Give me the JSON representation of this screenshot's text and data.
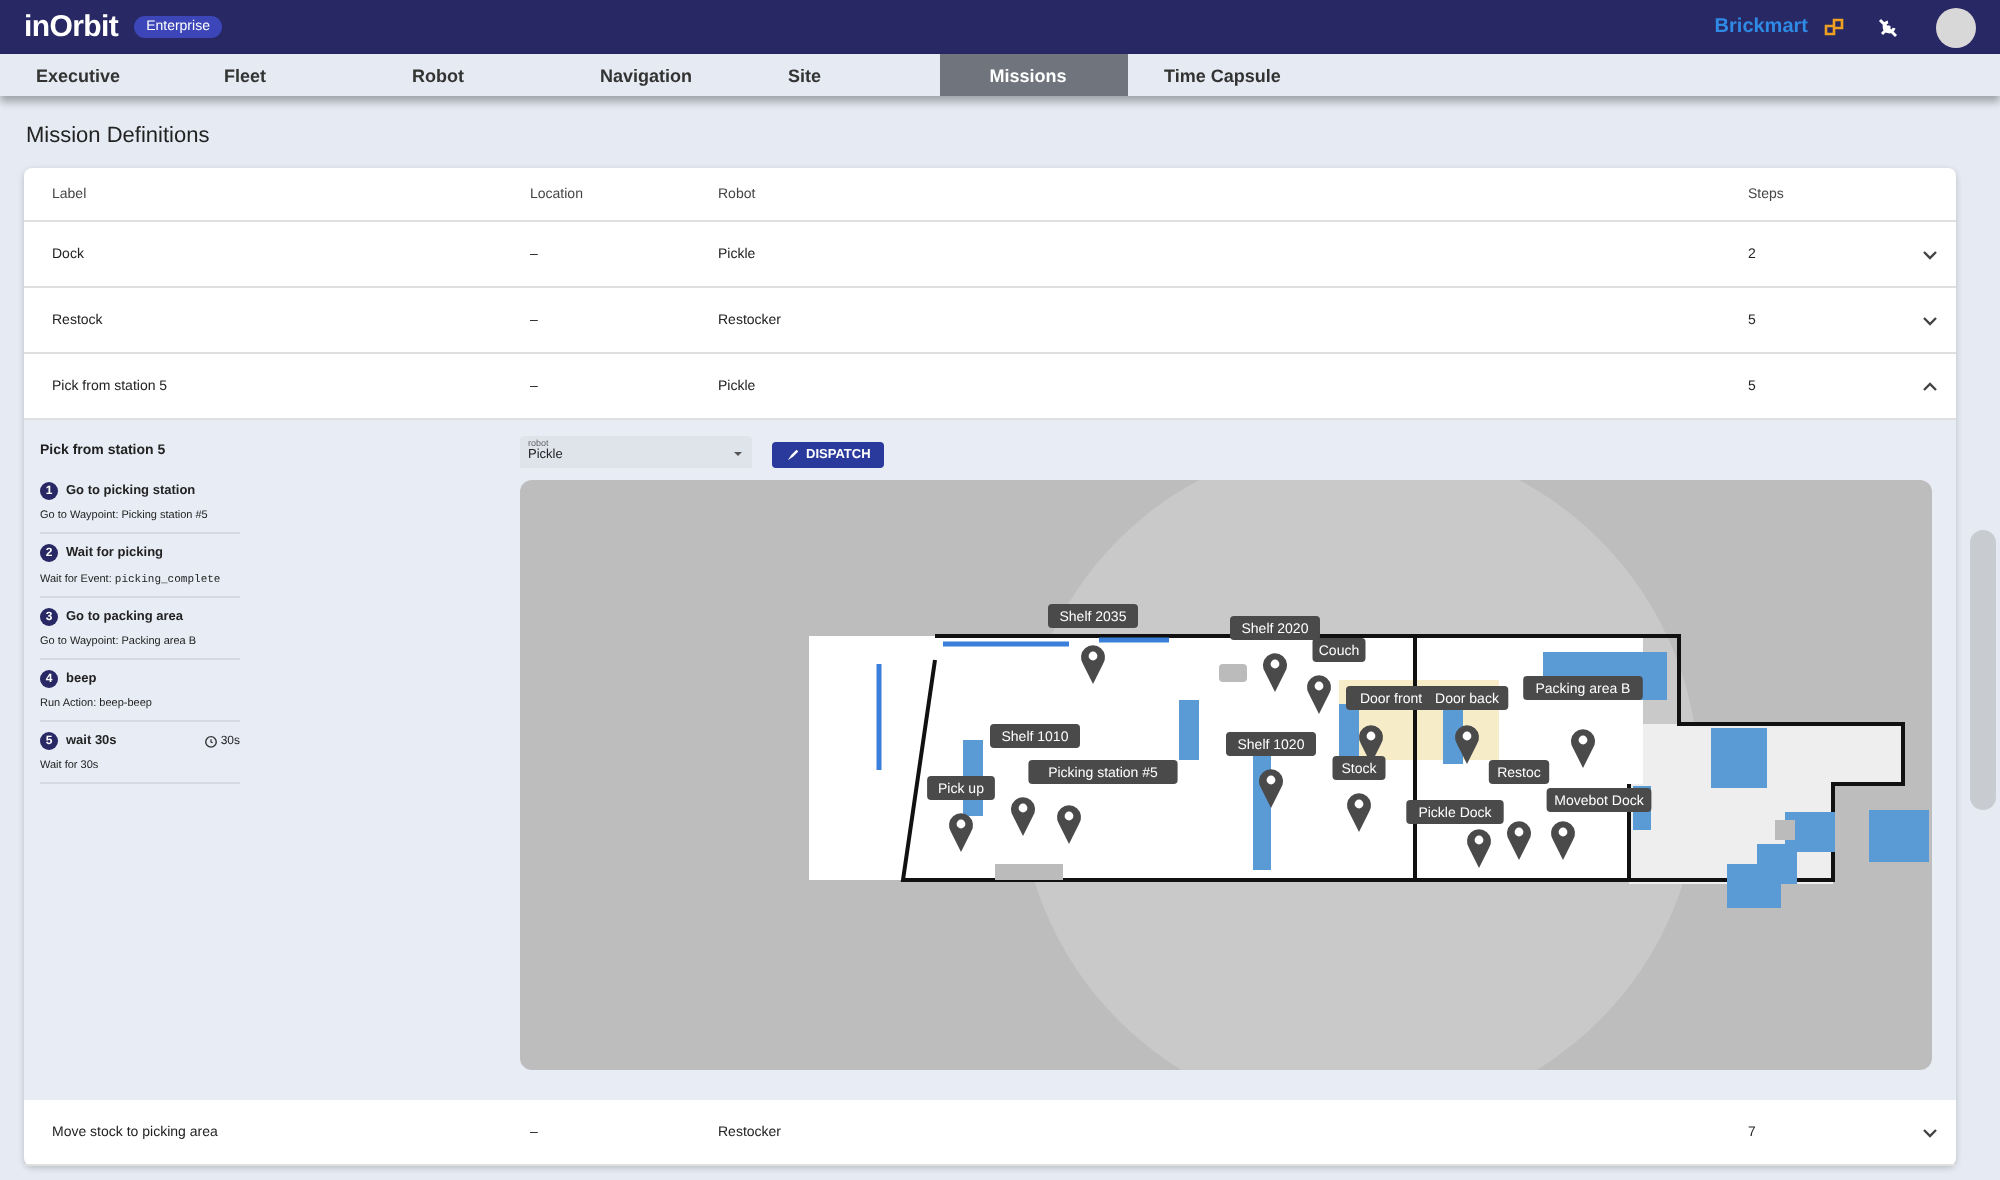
{
  "header": {
    "logo": "inOrbit",
    "edition": "Enterprise",
    "customer": "Brickmart"
  },
  "tabs": [
    {
      "label": "Executive",
      "selected": false
    },
    {
      "label": "Fleet",
      "selected": false
    },
    {
      "label": "Robot",
      "selected": false
    },
    {
      "label": "Navigation",
      "selected": false
    },
    {
      "label": "Site",
      "selected": false
    },
    {
      "label": "Missions",
      "selected": true
    },
    {
      "label": "Time Capsule",
      "selected": false
    }
  ],
  "page_title": "Mission Definitions",
  "table": {
    "columns": [
      "Label",
      "Location",
      "Robot",
      "Steps"
    ],
    "rows": [
      {
        "label": "Dock",
        "location": "–",
        "robot": "Pickle",
        "steps": "2",
        "expanded": false
      },
      {
        "label": "Restock",
        "location": "–",
        "robot": "Restocker",
        "steps": "5",
        "expanded": false
      },
      {
        "label": "Pick from station 5",
        "location": "–",
        "robot": "Pickle",
        "steps": "5",
        "expanded": true
      },
      {
        "label": "Move stock to picking area",
        "location": "–",
        "robot": "Restocker",
        "steps": "7",
        "expanded": false
      }
    ]
  },
  "detail": {
    "title": "Pick from station 5",
    "steps": [
      {
        "number": "1",
        "title": "Go to picking station",
        "description": "Go to Waypoint: Picking station #5"
      },
      {
        "number": "2",
        "title": "Wait for picking",
        "description": "Wait for Event:",
        "code": "picking_complete"
      },
      {
        "number": "3",
        "title": "Go to packing area",
        "description": "Go to Waypoint: Packing area B"
      },
      {
        "number": "4",
        "title": "beep",
        "description": "Run Action: beep-beep"
      },
      {
        "number": "5",
        "title": "wait 30s",
        "description": "Wait for 30s",
        "duration": "30s"
      }
    ],
    "robot_select": {
      "label": "robot",
      "value": "Pickle"
    },
    "dispatch_button": "DISPATCH",
    "map_markers": [
      {
        "label": "Shelf 2035"
      },
      {
        "label": "Shelf 2020"
      },
      {
        "label": "Couch"
      },
      {
        "label": "Door front"
      },
      {
        "label": "Door back"
      },
      {
        "label": "Packing area B"
      },
      {
        "label": "Shelf 1020"
      },
      {
        "label": "Stock"
      },
      {
        "label": "Pick up"
      },
      {
        "label": "Shelf 1010"
      },
      {
        "label": "Picking station #5"
      },
      {
        "label": "Restoc"
      },
      {
        "label": "Movebot Dock"
      },
      {
        "label": "Pickle Dock"
      }
    ]
  }
}
